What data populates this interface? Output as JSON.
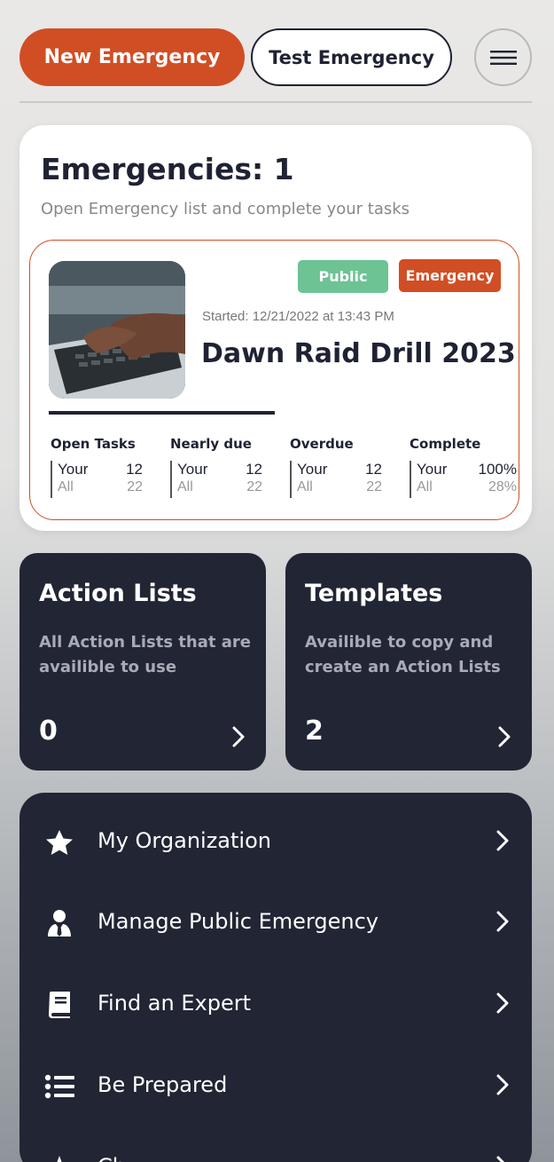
{
  "header": {
    "new_emergency_label": "New Emergency",
    "test_emergency_label": "Test Emergency"
  },
  "emergencies": {
    "title": "Emergencies: 1",
    "subtitle": "Open Emergency list and complete your tasks",
    "item": {
      "badge_public": "Public",
      "badge_type": "Emergency",
      "started": "Started: 12/21/2022 at 13:43 PM",
      "name": "Dawn Raid Drill 2023",
      "stats": [
        {
          "label": "Open Tasks",
          "your_label": "Your",
          "your_value": "12",
          "all_label": "All",
          "all_value": "22"
        },
        {
          "label": "Nearly due",
          "your_label": "Your",
          "your_value": "12",
          "all_label": "All",
          "all_value": "22"
        },
        {
          "label": "Overdue",
          "your_label": "Your",
          "your_value": "12",
          "all_label": "All",
          "all_value": "22"
        },
        {
          "label": "Complete",
          "your_label": "Your",
          "your_value": "100%",
          "all_label": "All",
          "all_value": "28%"
        }
      ]
    }
  },
  "action_lists": {
    "title": "Action Lists",
    "description": "All Action Lists that are availible to use",
    "count": "0"
  },
  "templates": {
    "title": "Templates",
    "description": "Availible to copy and create an Action Lists",
    "count": "2"
  },
  "menu": {
    "items": [
      {
        "label": "My Organization",
        "icon": "star-icon"
      },
      {
        "label": "Manage Public Emergency",
        "icon": "user-tie-icon"
      },
      {
        "label": "Find an Expert",
        "icon": "book-icon"
      },
      {
        "label": "Be Prepared",
        "icon": "list-icon"
      },
      {
        "label": "Ch",
        "icon": "font-icon"
      }
    ]
  },
  "colors": {
    "accent": "#d14e24",
    "public_badge": "#6dc394",
    "dark_card": "#222534",
    "text_dark": "#1f2233"
  }
}
